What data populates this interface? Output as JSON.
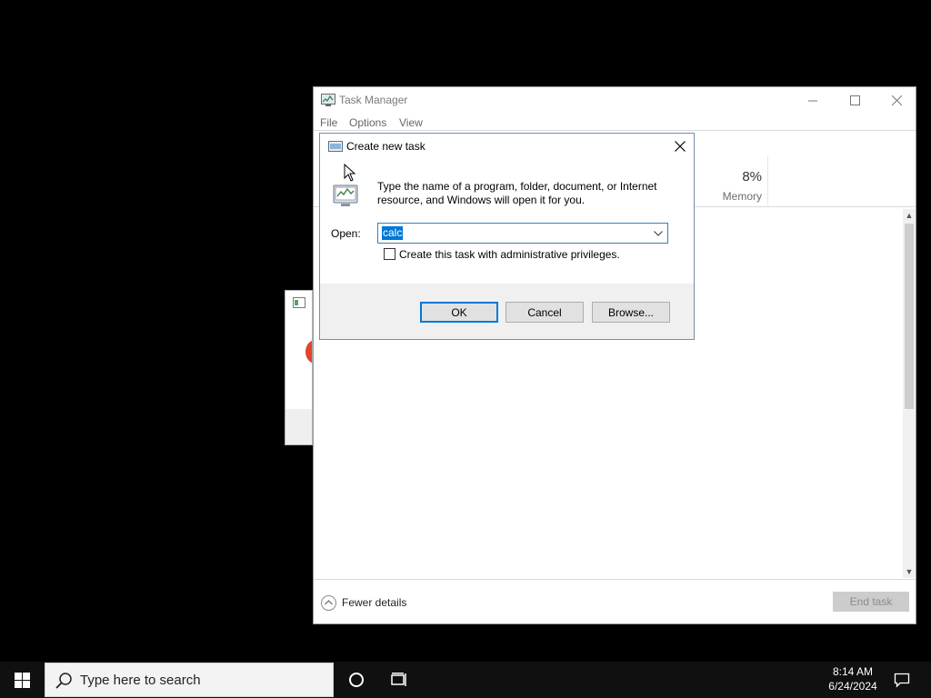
{
  "task_manager": {
    "title": "Task Manager",
    "menu": [
      "File",
      "Options",
      "View"
    ],
    "window_controls": [
      "minimize",
      "maximize",
      "close"
    ],
    "performance_column": {
      "value": "8%",
      "label": "Memory"
    },
    "fewer_details_label": "Fewer details",
    "end_task_label": "End task"
  },
  "dialog": {
    "title": "Create new task",
    "description": "Type the name of a program, folder, document, or Internet resource, and Windows will open it for you.",
    "open_label": "Open:",
    "open_value": "calc",
    "admin_checkbox_label": "Create this task with administrative privileges.",
    "admin_checked": false,
    "buttons": {
      "ok": "OK",
      "cancel": "Cancel",
      "browse": "Browse..."
    }
  },
  "taskbar": {
    "search_placeholder": "Type here to search",
    "time": "8:14 AM",
    "date": "6/24/2024"
  },
  "colors": {
    "desktop": "#000000",
    "taskbar": "#101010",
    "accent": "#0078d7"
  }
}
